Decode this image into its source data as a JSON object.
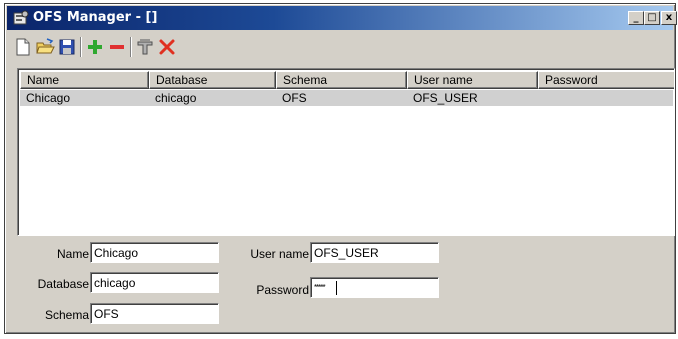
{
  "window": {
    "title": "OFS Manager - []",
    "controls": {
      "minimize": "_",
      "maximize": "□",
      "close": "x"
    }
  },
  "toolbar": {
    "icons": [
      "new-icon",
      "open-icon",
      "save-icon",
      "add-icon",
      "remove-icon",
      "connect-icon",
      "delete-icon"
    ]
  },
  "table": {
    "columns": [
      "Name",
      "Database",
      "Schema",
      "User name",
      "Password"
    ],
    "rows": [
      {
        "name": "Chicago",
        "database": "chicago",
        "schema": "OFS",
        "user_name": "OFS_USER",
        "password": ""
      }
    ]
  },
  "form": {
    "name": {
      "label": "Name",
      "value": "Chicago"
    },
    "database": {
      "label": "Database",
      "value": "chicago"
    },
    "schema": {
      "label": "Schema",
      "value": "OFS"
    },
    "user_name": {
      "label": "User name",
      "value": "OFS_USER"
    },
    "password": {
      "label": "Password",
      "value": "*****"
    }
  },
  "colors": {
    "titlebar_start": "#0a246a",
    "titlebar_end": "#a6caf0",
    "window_face": "#d4d0c8",
    "selected_row": "#d0d0d0",
    "add_green": "#2fa82f",
    "remove_red": "#e03030"
  }
}
